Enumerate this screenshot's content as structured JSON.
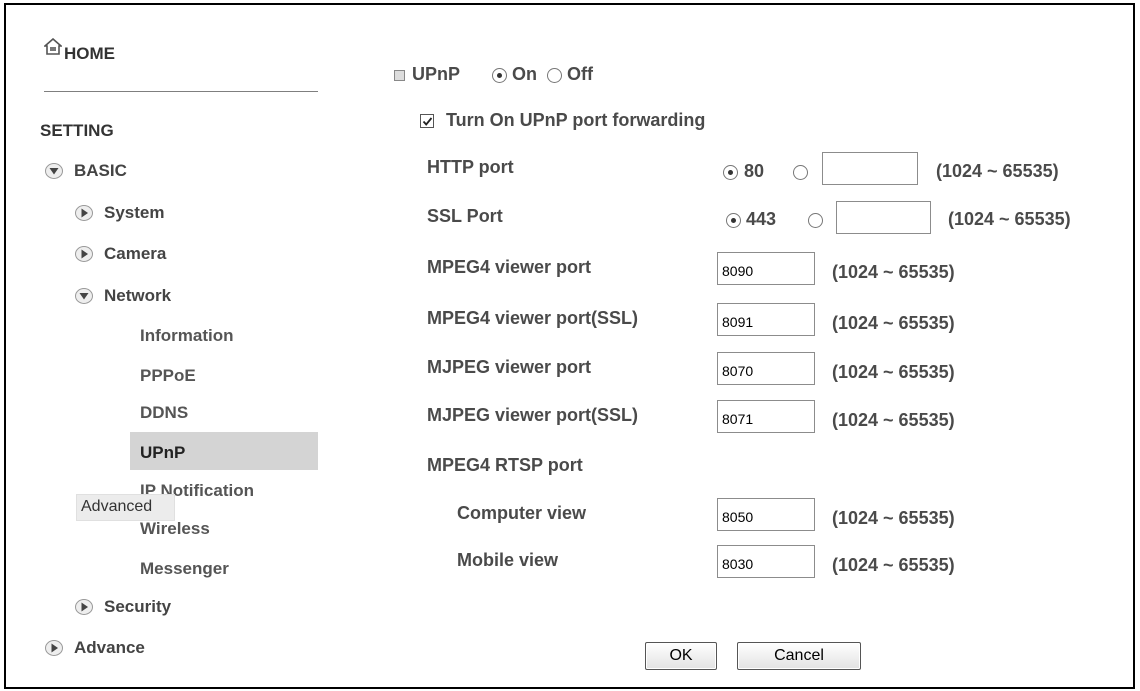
{
  "sidebar": {
    "home": "HOME",
    "setting": "SETTING",
    "basic": "BASIC",
    "system": "System",
    "camera": "Camera",
    "network": "Network",
    "network_items": [
      "Information",
      "PPPoE",
      "DDNS",
      "UPnP",
      "IP Notification",
      "Wireless",
      "Messenger"
    ],
    "security": "Security",
    "advance": "Advance",
    "tooltip": "Advanced"
  },
  "upnp": {
    "label": "UPnP",
    "on": "On",
    "off": "Off",
    "selected": "On",
    "forwarding_label": "Turn On UPnP port forwarding",
    "forwarding_checked": true
  },
  "ports": {
    "http": {
      "label": "HTTP port",
      "default": "80",
      "custom": "",
      "range": "(1024 ~ 65535)"
    },
    "ssl": {
      "label": "SSL Port",
      "default": "443",
      "custom": "",
      "range": "(1024 ~ 65535)"
    },
    "mpeg4": {
      "label": "MPEG4 viewer port",
      "value": "8090",
      "range": "(1024 ~ 65535)"
    },
    "mpeg4_ssl": {
      "label": "MPEG4 viewer port(SSL)",
      "value": "8091",
      "range": "(1024 ~ 65535)"
    },
    "mjpeg": {
      "label": "MJPEG viewer port",
      "value": "8070",
      "range": "(1024 ~ 65535)"
    },
    "mjpeg_ssl": {
      "label": "MJPEG viewer port(SSL)",
      "value": "8071",
      "range": "(1024 ~ 65535)"
    },
    "rtsp_heading": "MPEG4 RTSP port",
    "computer": {
      "label": "Computer view",
      "value": "8050",
      "range": "(1024 ~ 65535)"
    },
    "mobile": {
      "label": "Mobile view",
      "value": "8030",
      "range": "(1024 ~ 65535)"
    }
  },
  "buttons": {
    "ok": "OK",
    "cancel": "Cancel"
  }
}
